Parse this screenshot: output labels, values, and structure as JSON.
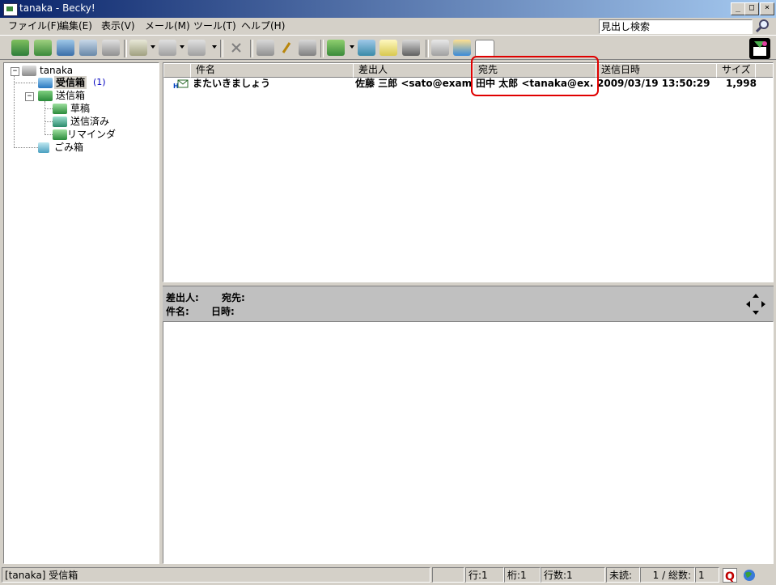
{
  "window": {
    "title": "tanaka - Becky!",
    "minimize": "_",
    "maximize": "□",
    "close": "×"
  },
  "menu": [
    "ファイル(F)",
    "編集(E)",
    "表示(V)",
    "メール(M)",
    "ツール(T)",
    "ヘルプ(H)"
  ],
  "search": {
    "value": "見出し検索"
  },
  "tree": {
    "account": "tanaka",
    "inbox": "受信箱",
    "inbox_count": "(1)",
    "outbox": "送信箱",
    "drafts": "草稿",
    "sent": "送信済み",
    "reminder": "リマインダ",
    "trash": "ごみ箱"
  },
  "list": {
    "columns": {
      "subject": "件名",
      "from": "差出人",
      "to": "宛先",
      "date": "送信日時",
      "size": "サイズ"
    },
    "rows": [
      {
        "subject": "またいきましょう",
        "from": "佐藤 三郎 <sato@exam...",
        "to": "田中 太郎 <tanaka@ex...",
        "date": "2009/03/19 13:50:29",
        "size": "1,998"
      }
    ]
  },
  "preview": {
    "from_label": "差出人:",
    "to_label": "宛先:",
    "subject_label": "件名:",
    "date_label": "日時:"
  },
  "status": {
    "folder": "[tanaka] 受信箱",
    "row": "行:1",
    "col": "桁:1",
    "lines": "行数:1",
    "unread": "未読:",
    "counts": "1 / 総数:",
    "total": "1"
  },
  "colors": {
    "titlebar_start": "#0a246a",
    "titlebar_end": "#a6caf0",
    "highlight": "#e00000",
    "accent_green": "#3a8a3a"
  }
}
